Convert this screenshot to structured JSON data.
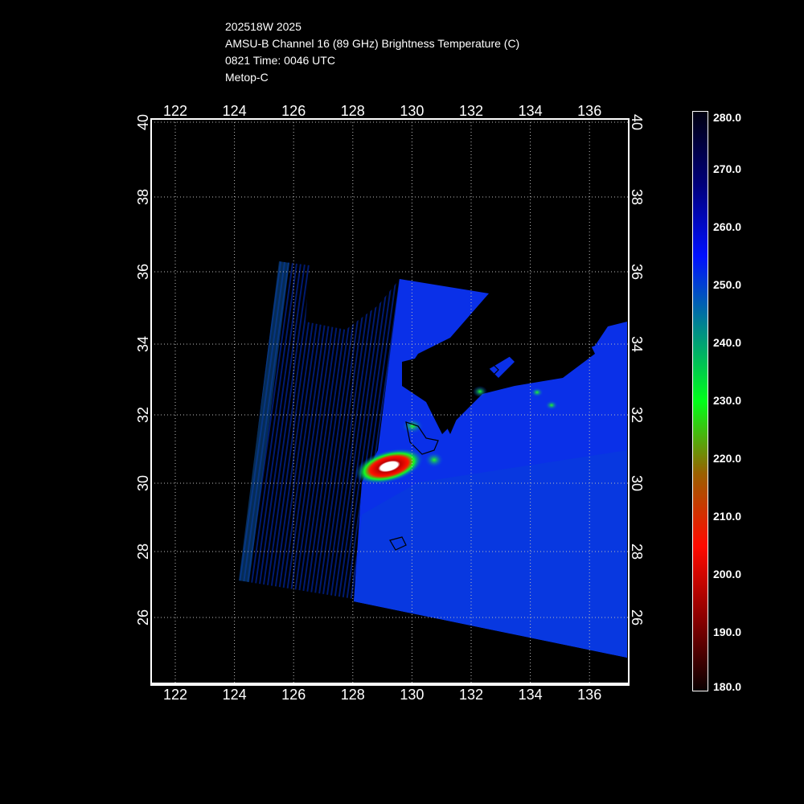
{
  "title_lines": [
    "202518W 2025",
    "AMSU-B Channel 16 (89 GHz) Brightness Temperature (C)",
    "0821 Time: 0046 UTC",
    "Metop-C"
  ],
  "map": {
    "lon_ticks": [
      "122",
      "124",
      "126",
      "128",
      "130",
      "132",
      "134",
      "136"
    ],
    "lat_ticks": [
      "40",
      "38",
      "36",
      "34",
      "32",
      "30",
      "28",
      "26"
    ],
    "grid": true
  },
  "colorbar": {
    "labels": [
      "280.0",
      "270.0",
      "260.0",
      "250.0",
      "240.0",
      "230.0",
      "220.0",
      "210.0",
      "200.0",
      "190.0",
      "180.0"
    ],
    "min": 180,
    "max": 280,
    "colors": [
      "#0a0000",
      "#8a0000",
      "#ff0a00",
      "#9a6000",
      "#00ff1a",
      "#008a8a",
      "#0010ff",
      "#00007a",
      "#000010"
    ]
  }
}
